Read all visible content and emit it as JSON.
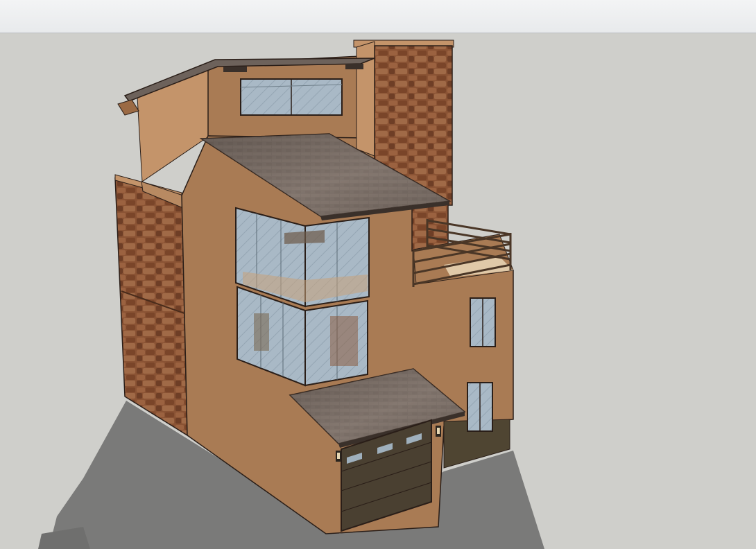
{
  "app": {
    "toolbar_label": "",
    "viewport_label": ""
  },
  "scene": {
    "subject": "three-story-house-model",
    "colors": {
      "sky": "#cfcfcb",
      "ground_shadow": "#7a7a79",
      "stucco_front": "#a97b54",
      "stucco_side": "#c4946a",
      "roof": "#6d625b",
      "roof_light": "#8c7f76",
      "stone": "#8a5334",
      "glass": "#a9b9c6",
      "garage_door": "#4a4031",
      "railing": "#4a3626"
    },
    "icons": [
      "wall-lantern-icon",
      "wall-lantern-icon"
    ]
  }
}
